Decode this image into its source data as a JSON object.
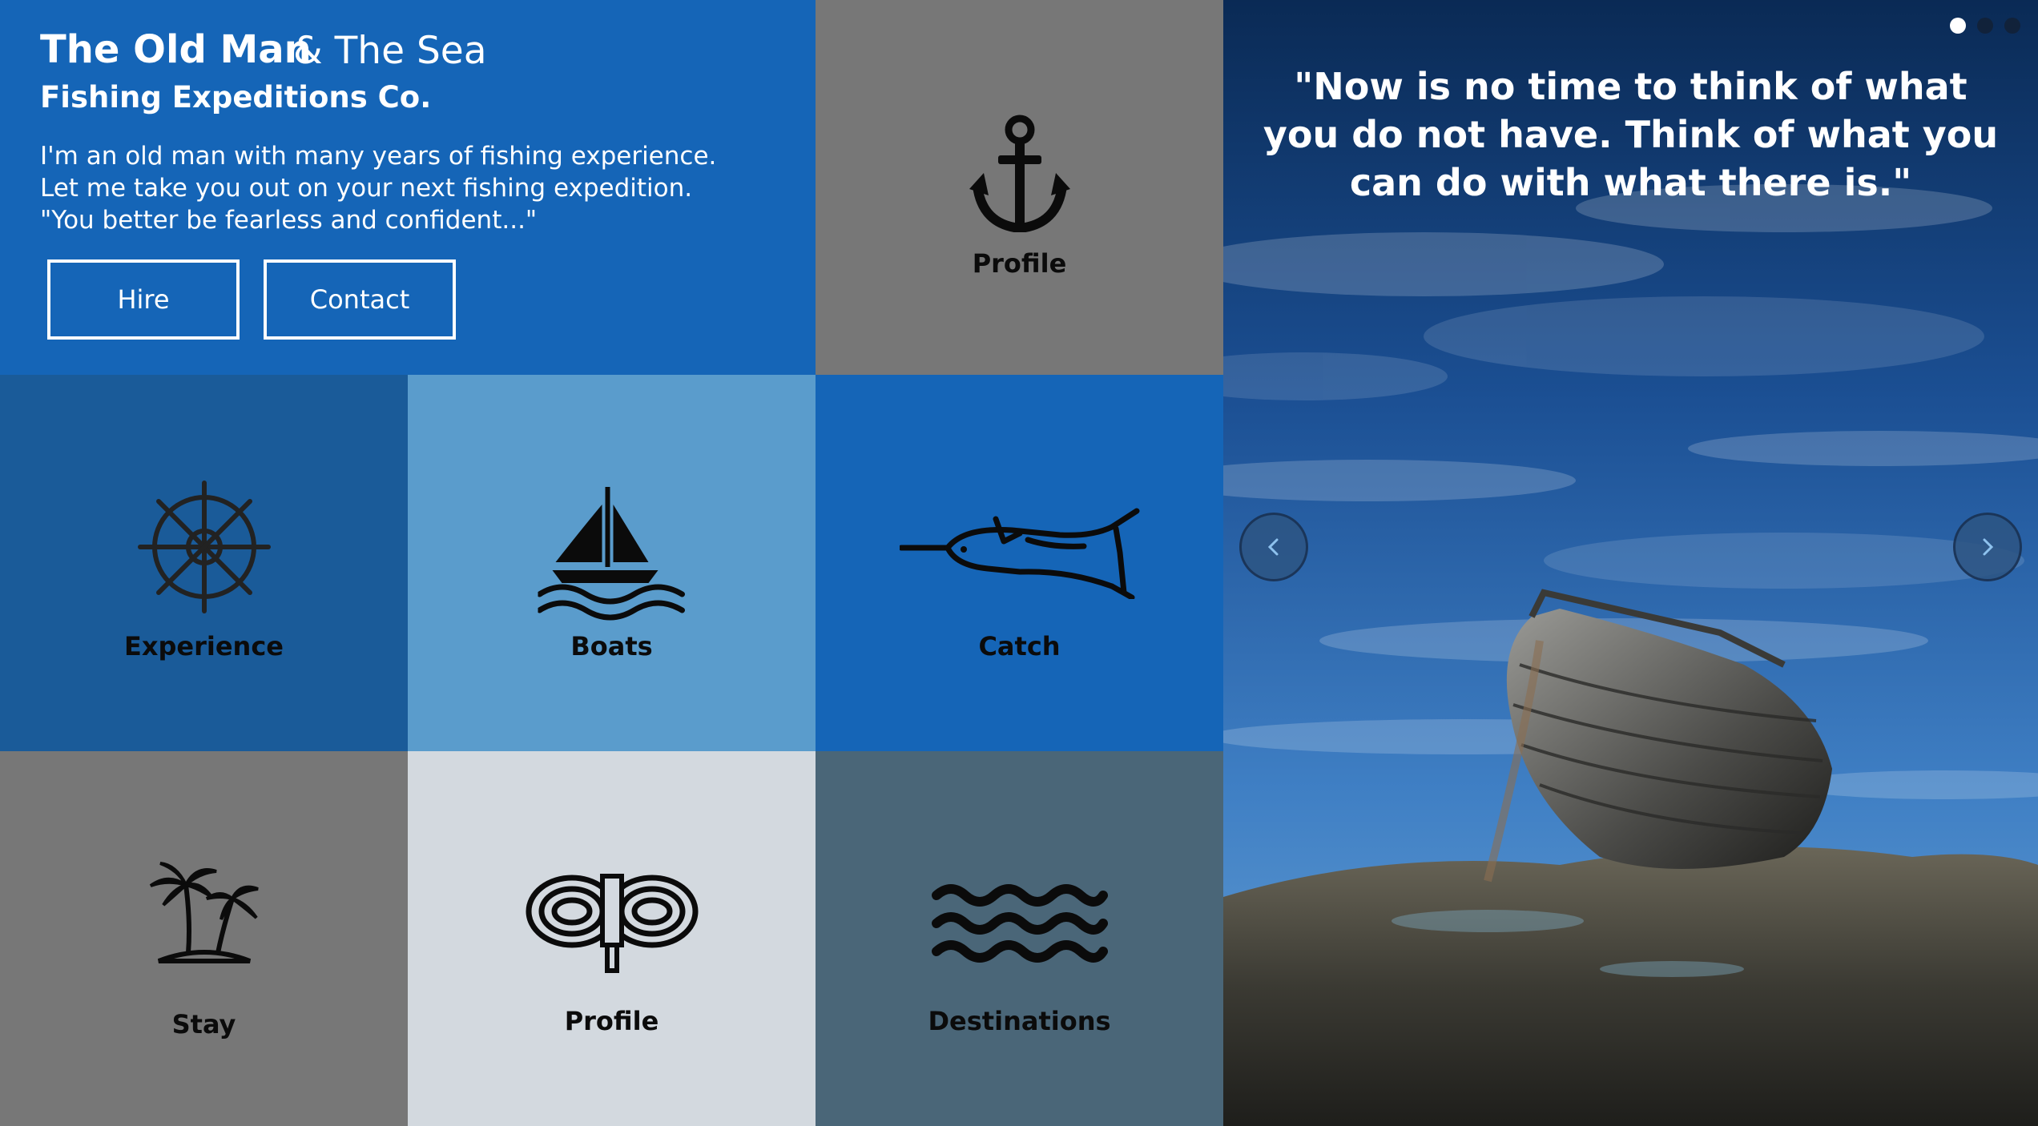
{
  "header": {
    "brand_bold": "The Old Man",
    "brand_light": "& The Sea",
    "tagline": "Fishing Expeditions Co.",
    "description_lines": [
      "I'm an old man with many years of fishing experience.",
      "Let me take you out on your next fishing expedition.",
      "\"You better be fearless and confident...\""
    ],
    "buttons": {
      "hire": "Hire",
      "contact": "Contact"
    }
  },
  "tiles": {
    "profile_top": {
      "label": "Profile",
      "icon": "anchor-icon"
    },
    "experience": {
      "label": "Experience",
      "icon": "ship-wheel-icon"
    },
    "boats": {
      "label": "Boats",
      "icon": "sailboat-icon"
    },
    "catch": {
      "label": "Catch",
      "icon": "swordfish-icon"
    },
    "stay": {
      "label": "Stay",
      "icon": "palm-tree-icon"
    },
    "profile_bottom": {
      "label": "Profile",
      "icon": "rope-knot-icon"
    },
    "destinations": {
      "label": "Destinations",
      "icon": "waves-icon"
    }
  },
  "slider": {
    "quote": "\"Now is no time to think of what you do not have. Think of what you can do with what there is.\"",
    "slides_count": 3,
    "active_slide": 1,
    "prev_icon": "chevron-left-icon",
    "next_icon": "chevron-right-icon"
  },
  "colors": {
    "primary_blue": "#1565b7",
    "dark_blue": "#1a5b99",
    "light_blue": "#5a9ccc",
    "gray": "#777777",
    "light_gray": "#d3d9df",
    "slate": "#4a6678"
  }
}
